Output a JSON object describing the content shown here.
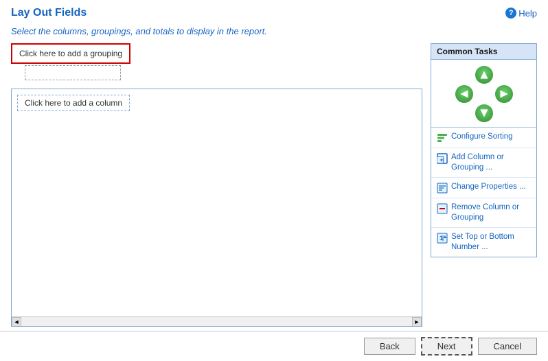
{
  "header": {
    "title": "Lay Out Fields",
    "help_label": "Help"
  },
  "description": {
    "text_before": "Select the columns, groupings, and totals to ",
    "highlight": "display",
    "text_after": " in the report."
  },
  "left_panel": {
    "grouping_btn_label": "Click here to add a grouping",
    "column_btn_label": "Click here to add a column",
    "scrollbar": {
      "left_arrow": "◄",
      "right_arrow": "►"
    }
  },
  "common_tasks": {
    "title": "Common Tasks",
    "arrows": {
      "up": "▲",
      "down": "▼",
      "left": "◄",
      "right": "►"
    },
    "items": [
      {
        "id": "configure-sorting",
        "label": "Configure Sorting",
        "icon": "sort-icon"
      },
      {
        "id": "add-column-grouping",
        "label": "Add Column or Grouping ...",
        "icon": "add-icon"
      },
      {
        "id": "change-properties",
        "label": "Change Properties ...",
        "icon": "properties-icon"
      },
      {
        "id": "remove-column-grouping",
        "label": "Remove Column or Grouping",
        "icon": "remove-icon"
      },
      {
        "id": "set-top-bottom",
        "label": "Set Top or Bottom Number ...",
        "icon": "topbottom-icon"
      }
    ]
  },
  "footer": {
    "back_label": "Back",
    "next_label": "Next",
    "cancel_label": "Cancel"
  }
}
